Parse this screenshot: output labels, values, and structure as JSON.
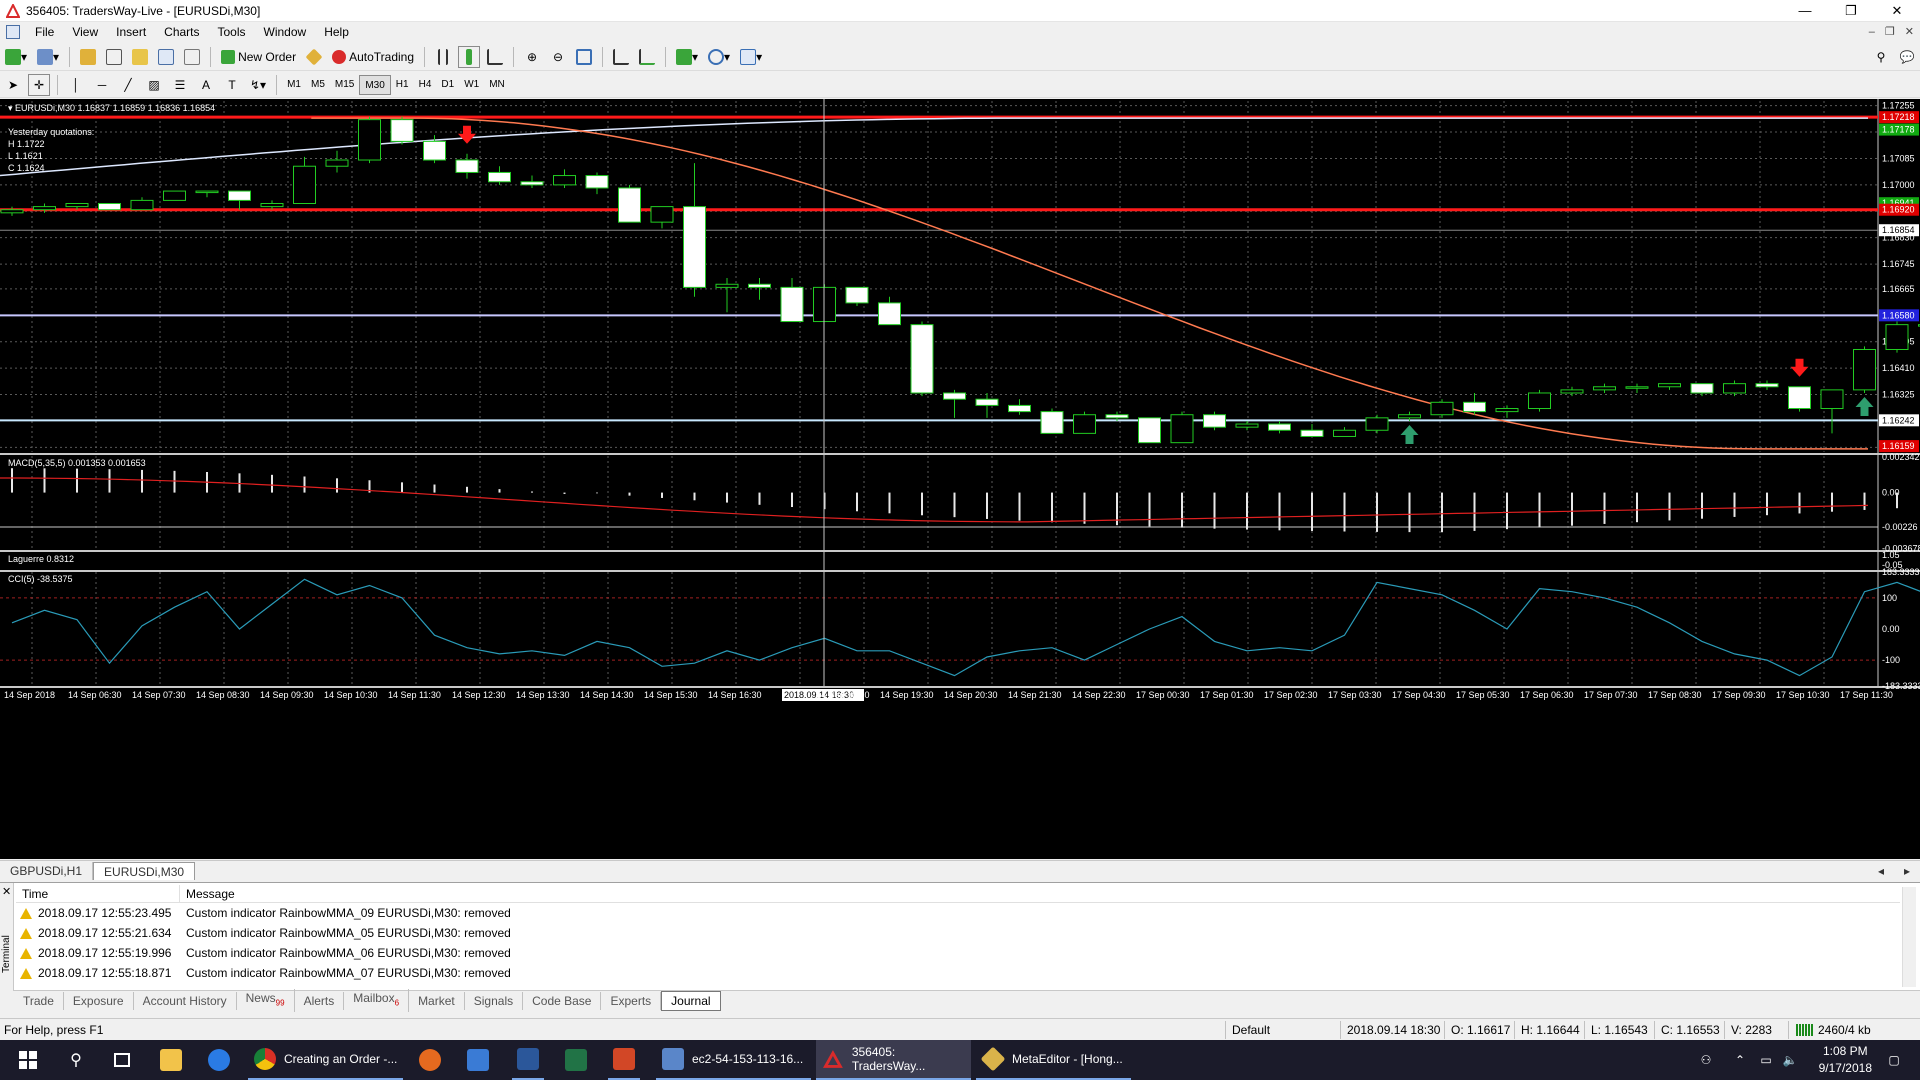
{
  "window": {
    "title": "356405: TradersWay-Live - [EURUSDi,M30]",
    "controls": [
      "—",
      "❐",
      "✕"
    ]
  },
  "menu": [
    "File",
    "View",
    "Insert",
    "Charts",
    "Tools",
    "Window",
    "Help"
  ],
  "toolbar": {
    "new_order": "New Order",
    "auto_trading": "AutoTrading",
    "timeframes": [
      "M1",
      "M5",
      "M15",
      "M30",
      "H1",
      "H4",
      "D1",
      "W1",
      "MN"
    ],
    "active_timeframe": "M30"
  },
  "chart": {
    "header": "EURUSDi,M30 1.16837 1.16859 1.16836 1.16854",
    "yesterday": [
      "Yesterday quotations:",
      "H 1.1722",
      "L 1.1621",
      "C 1.1624"
    ],
    "crosshair_label": "2018.09.14 18:30",
    "price_levels": [
      "1.17255",
      "1.17170",
      "1.17085",
      "1.17000",
      "1.16915",
      "1.16830",
      "1.16745",
      "1.16665",
      "1.16580",
      "1.16495",
      "1.16410",
      "1.16325",
      "1.16242",
      "1.16155"
    ],
    "price_marks": [
      {
        "label": "1.17218",
        "price": 1.17218,
        "color": "#e00000"
      },
      {
        "label": "1.17178",
        "price": 1.17178,
        "color": "#11aa11"
      },
      {
        "label": "1.16941",
        "price": 1.16941,
        "color": "#11aa11"
      },
      {
        "label": "1.16920",
        "price": 1.1692,
        "color": "#e00000"
      },
      {
        "label": "1.16854",
        "price": 1.16854,
        "color": "#ffffff"
      },
      {
        "label": "1.16580",
        "price": 1.1658,
        "color": "#2222dd"
      },
      {
        "label": "1.16242",
        "price": 1.16242,
        "color": "#ffffff"
      },
      {
        "label": "1.16159",
        "price": 1.16159,
        "color": "#e00000"
      }
    ],
    "macd_label": "MACD(5,35,5) 0.001353 0.001653",
    "macd_levels": [
      "0.002342",
      "0.00",
      "-0.00226",
      "-0.003678"
    ],
    "laguerre_label": "Laguerre 0.8312",
    "laguerre_levels": [
      "1.05",
      "-0.05"
    ],
    "cci_label": "CCI(5) -38.5375",
    "cci_levels": [
      "183.3333",
      "100",
      "0.00",
      "-100",
      "-183.3333"
    ],
    "time_labels": [
      "14 Sep 2018",
      "14 Sep 06:30",
      "14 Sep 07:30",
      "14 Sep 08:30",
      "14 Sep 09:30",
      "14 Sep 10:30",
      "14 Sep 11:30",
      "14 Sep 12:30",
      "14 Sep 13:30",
      "14 Sep 14:30",
      "14 Sep 15:30",
      "14 Sep 16:30",
      "2018.09.14 18:30",
      "14 Sep 18:30",
      "14 Sep 19:30",
      "14 Sep 20:30",
      "14 Sep 21:30",
      "14 Sep 22:30",
      "17 Sep 00:30",
      "17 Sep 01:30",
      "17 Sep 02:30",
      "17 Sep 03:30",
      "17 Sep 04:30",
      "17 Sep 05:30",
      "17 Sep 06:30",
      "17 Sep 07:30",
      "17 Sep 08:30",
      "17 Sep 09:30",
      "17 Sep 10:30",
      "17 Sep 11:30"
    ]
  },
  "chart_data": {
    "type": "candlestick",
    "candles": [
      [
        1.1691,
        1.1693,
        1.169,
        1.1692
      ],
      [
        1.1692,
        1.1694,
        1.1691,
        1.1693
      ],
      [
        1.1693,
        1.1694,
        1.1692,
        1.1694
      ],
      [
        1.1694,
        1.1694,
        1.1692,
        1.1692
      ],
      [
        1.1692,
        1.1696,
        1.1692,
        1.1695
      ],
      [
        1.1695,
        1.1698,
        1.1695,
        1.1698
      ],
      [
        1.1698,
        1.1698,
        1.1696,
        1.1698
      ],
      [
        1.1698,
        1.1698,
        1.1692,
        1.1695
      ],
      [
        1.1693,
        1.1695,
        1.1692,
        1.1694
      ],
      [
        1.1694,
        1.1709,
        1.1694,
        1.1706
      ],
      [
        1.1706,
        1.1711,
        1.1704,
        1.1708
      ],
      [
        1.1708,
        1.1722,
        1.1707,
        1.1721
      ],
      [
        1.1721,
        1.1722,
        1.1713,
        1.1714
      ],
      [
        1.1714,
        1.1716,
        1.1707,
        1.1708
      ],
      [
        1.1708,
        1.171,
        1.1702,
        1.1704
      ],
      [
        1.1704,
        1.1706,
        1.17,
        1.1701
      ],
      [
        1.1701,
        1.1703,
        1.1699,
        1.17
      ],
      [
        1.17,
        1.1705,
        1.1699,
        1.1703
      ],
      [
        1.1703,
        1.1704,
        1.1697,
        1.1699
      ],
      [
        1.1699,
        1.17,
        1.1688,
        1.1688
      ],
      [
        1.1688,
        1.1693,
        1.1686,
        1.1693
      ],
      [
        1.1693,
        1.1707,
        1.1664,
        1.1667
      ],
      [
        1.1667,
        1.167,
        1.1659,
        1.1668
      ],
      [
        1.1668,
        1.167,
        1.1663,
        1.1667
      ],
      [
        1.1667,
        1.167,
        1.1656,
        1.1656
      ],
      [
        1.1656,
        1.1668,
        1.1656,
        1.1667
      ],
      [
        1.1667,
        1.1667,
        1.1661,
        1.1662
      ],
      [
        1.1662,
        1.1664,
        1.1655,
        1.1655
      ],
      [
        1.1655,
        1.1656,
        1.1632,
        1.1633
      ],
      [
        1.1633,
        1.1634,
        1.1625,
        1.1631
      ],
      [
        1.1631,
        1.1633,
        1.1625,
        1.1629
      ],
      [
        1.1629,
        1.1631,
        1.1626,
        1.1627
      ],
      [
        1.1627,
        1.1628,
        1.162,
        1.162
      ],
      [
        1.162,
        1.1627,
        1.162,
        1.1626
      ],
      [
        1.1626,
        1.1627,
        1.1624,
        1.1625
      ],
      [
        1.1625,
        1.1625,
        1.1617,
        1.1617
      ],
      [
        1.1617,
        1.1627,
        1.1617,
        1.1626
      ],
      [
        1.1626,
        1.1627,
        1.1621,
        1.1622
      ],
      [
        1.1622,
        1.1624,
        1.1621,
        1.1623
      ],
      [
        1.1623,
        1.1624,
        1.162,
        1.1621
      ],
      [
        1.1621,
        1.1623,
        1.1619,
        1.1619
      ],
      [
        1.1619,
        1.1622,
        1.1619,
        1.1621
      ],
      [
        1.1621,
        1.1626,
        1.162,
        1.1625
      ],
      [
        1.1625,
        1.1627,
        1.1624,
        1.1626
      ],
      [
        1.1626,
        1.1631,
        1.1625,
        1.163
      ],
      [
        1.163,
        1.1633,
        1.1626,
        1.1627
      ],
      [
        1.1627,
        1.1629,
        1.1625,
        1.1628
      ],
      [
        1.1628,
        1.1634,
        1.1627,
        1.1633
      ],
      [
        1.1633,
        1.1635,
        1.1632,
        1.1634
      ],
      [
        1.1634,
        1.1636,
        1.1633,
        1.1635
      ],
      [
        1.1635,
        1.1636,
        1.1633,
        1.1635
      ],
      [
        1.1635,
        1.1636,
        1.1634,
        1.1636
      ],
      [
        1.1636,
        1.1636,
        1.1632,
        1.1633
      ],
      [
        1.1633,
        1.1637,
        1.1632,
        1.1636
      ],
      [
        1.1636,
        1.1637,
        1.1634,
        1.1635
      ],
      [
        1.1635,
        1.1635,
        1.1627,
        1.1628
      ],
      [
        1.1628,
        1.1634,
        1.162,
        1.1634
      ],
      [
        1.1634,
        1.1648,
        1.1633,
        1.1647
      ],
      [
        1.1647,
        1.1656,
        1.1646,
        1.1655
      ],
      [
        1.1655,
        1.166,
        1.1652,
        1.1655
      ]
    ],
    "signals": [
      {
        "bar": 14,
        "dir": "down"
      },
      {
        "bar": 43,
        "dir": "up"
      },
      {
        "bar": 55,
        "dir": "down"
      },
      {
        "bar": 57,
        "dir": "up"
      }
    ]
  },
  "chart_tabs": [
    "GBPUSDi,H1",
    "EURUSDi,M30"
  ],
  "active_chart_tab": "EURUSDi,M30",
  "terminal": {
    "headers": [
      "Time",
      "Message"
    ],
    "rows": [
      {
        "time": "2018.09.17 12:55:23.495",
        "message": "Custom indicator RainbowMMA_09 EURUSDi,M30: removed"
      },
      {
        "time": "2018.09.17 12:55:21.634",
        "message": "Custom indicator RainbowMMA_05 EURUSDi,M30: removed"
      },
      {
        "time": "2018.09.17 12:55:19.996",
        "message": "Custom indicator RainbowMMA_06 EURUSDi,M30: removed"
      },
      {
        "time": "2018.09.17 12:55:18.871",
        "message": "Custom indicator RainbowMMA_07 EURUSDi,M30: removed"
      }
    ],
    "side_label": "Terminal",
    "tabs": [
      {
        "label": "Trade",
        "badge": ""
      },
      {
        "label": "Exposure",
        "badge": ""
      },
      {
        "label": "Account History",
        "badge": ""
      },
      {
        "label": "News",
        "badge": "99"
      },
      {
        "label": "Alerts",
        "badge": ""
      },
      {
        "label": "Mailbox",
        "badge": "6"
      },
      {
        "label": "Market",
        "badge": ""
      },
      {
        "label": "Signals",
        "badge": ""
      },
      {
        "label": "Code Base",
        "badge": ""
      },
      {
        "label": "Experts",
        "badge": ""
      },
      {
        "label": "Journal",
        "badge": ""
      }
    ],
    "active_tab": "Journal"
  },
  "status": {
    "help": "For Help, press F1",
    "profile": "Default",
    "datetime": "2018.09.14 18:30",
    "open": "O: 1.16617",
    "high": "H: 1.16644",
    "low": "L: 1.16543",
    "close": "C: 1.16553",
    "volume": "V: 2283",
    "traffic": "2460/4 kb"
  },
  "taskbar": {
    "items": [
      {
        "label": "Creating an Order -...",
        "icon": "chrome-icon",
        "color": "#e8b400"
      },
      {
        "label": "ec2-54-153-113-16...",
        "icon": "remote-desktop-icon",
        "color": "#5a86c9"
      },
      {
        "label": "356405: TradersWay...",
        "icon": "metatrader-icon",
        "color": "#d92b2b"
      },
      {
        "label": "MetaEditor - [Hong...",
        "icon": "metaeditor-icon",
        "color": "#d9b34a"
      }
    ],
    "time": "1:08 PM",
    "date": "9/17/2018"
  }
}
